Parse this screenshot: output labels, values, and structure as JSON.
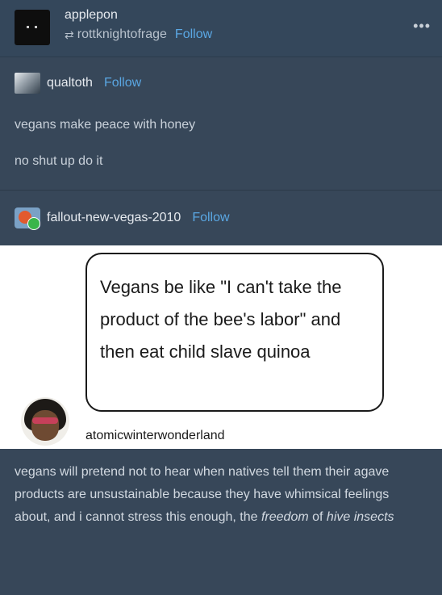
{
  "post": {
    "username": "applepon",
    "reblogged_from": "rottknightofrage",
    "follow_label": "Follow",
    "more_label": "•••"
  },
  "trail": [
    {
      "username": "qualtoth",
      "follow_label": "Follow",
      "lines": [
        "vegans make peace with honey",
        "no shut up do it"
      ]
    },
    {
      "username": "fallout-new-vegas-2010",
      "follow_label": "Follow",
      "image": {
        "bubble_text": "Vegans be like \"I can't take the product of the bee's labor\" and then eat child slave quinoa",
        "caption_username": "atomicwinterwonderland"
      }
    }
  ],
  "final_text": {
    "before": "vegans will pretend not to hear when natives tell them their agave products are unsustainable because they have whimsical feelings about, and i cannot stress this enough, the ",
    "emph1": "freedom",
    "middle": " of ",
    "emph2": "hive insects"
  }
}
